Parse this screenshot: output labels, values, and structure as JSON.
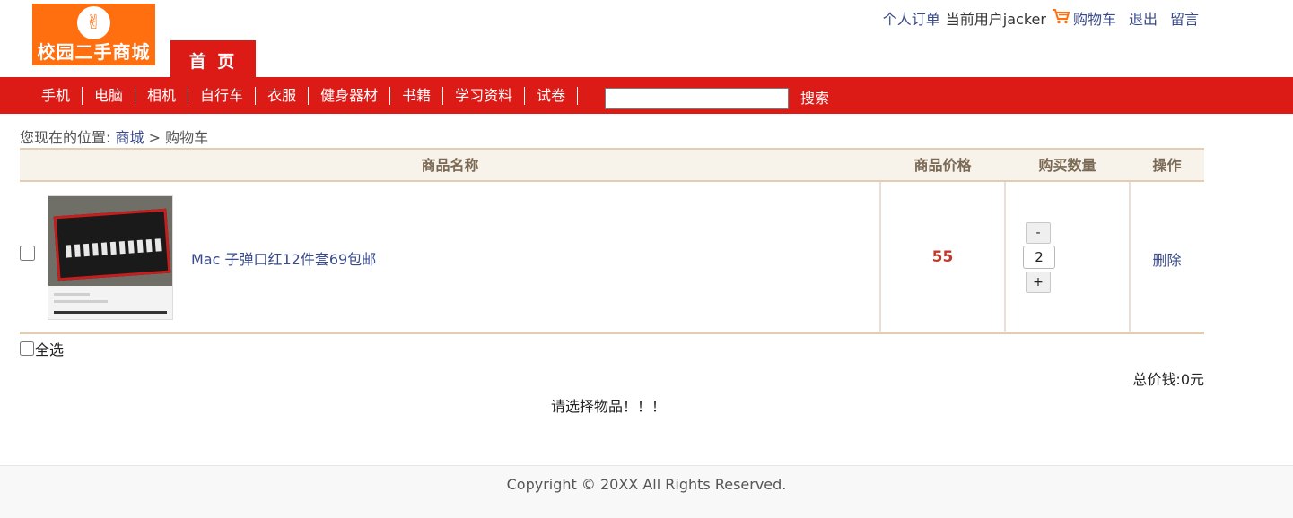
{
  "logo": {
    "emblem": "✌",
    "text": "校园二手商城"
  },
  "home_tab": "首 页",
  "top_links": {
    "orders": "个人订单",
    "current_user": "当前用户jacker",
    "cart": "购物车",
    "logout": "退出",
    "message": "留言"
  },
  "nav": {
    "categories": [
      "手机",
      "电脑",
      "相机",
      "自行车",
      "衣服",
      "健身器材",
      "书籍",
      "学习资料",
      "试卷"
    ],
    "search_value": "",
    "search_button": "搜索"
  },
  "breadcrumb": {
    "prefix": "您现在的位置:",
    "mall": "商城",
    "separator": ">",
    "current": "购物车"
  },
  "cart": {
    "headers": {
      "name": "商品名称",
      "price": "商品价格",
      "quantity": "购买数量",
      "action": "操作"
    },
    "items": [
      {
        "name": "Mac 子弹口红12件套69包邮",
        "price": "55",
        "quantity": "2",
        "minus": "-",
        "plus": "+",
        "delete": "删除",
        "checked": false
      }
    ],
    "select_all": "全选",
    "total": "总价钱:0元",
    "notice": "请选择物品！！！"
  },
  "footer": {
    "copyright": "Copyright © 20XX All Rights Reserved."
  },
  "colors": {
    "nav_red": "#dc1b17",
    "logo_orange": "#ff6f10",
    "link_blue": "#3a4a8a",
    "price_red": "#c0392b",
    "table_border": "#e2cdb3"
  }
}
